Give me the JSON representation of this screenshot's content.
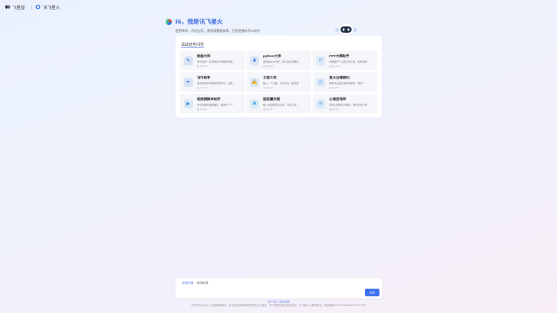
{
  "topbar": {
    "brand1": "飞星智",
    "brand2": "讯飞星火"
  },
  "hero": {
    "title": "Hi，我是讯飞星火",
    "subtitle": "使用简单，有问必答，提供海量模板库，打造更懂你的AI助手"
  },
  "card": {
    "heading": "试试这些问答",
    "assistants": [
      {
        "name": "绘画大师",
        "desc": "请你扮演一位资深设计师帮我构图…",
        "meta": "iFlyTEK",
        "icon": "paint-icon",
        "color": "#2f6be0"
      },
      {
        "name": "python大师",
        "desc": "我是python专家，请让我为您解答…",
        "meta": "iFlyTEK",
        "icon": "python-icon",
        "color": "#3b7ee0"
      },
      {
        "name": "PPT大纲助手",
        "desc": "请根据PPT主题生成大纲，结构清晰…",
        "meta": "iFlyTEK",
        "icon": "ppt-icon",
        "color": "#4d9ae6"
      },
      {
        "name": "写作助手",
        "desc": "请你扮演作家帮我构思写作，注意…",
        "meta": "iFlyTEK",
        "icon": "pen-icon",
        "color": "#2f6be0"
      },
      {
        "name": "文案大师",
        "desc": "输入一个主题，为你写出一篇文案",
        "meta": "iFlyTEK",
        "icon": "doc-icon",
        "color": "#3b7ee0"
      },
      {
        "name": "星火法律顾问",
        "desc": "提供专业的法律咨询服务，帮你…",
        "meta": "iFlyTEK",
        "icon": "scale-icon",
        "color": "#4d9ae6"
      },
      {
        "name": "短视频脚本助手",
        "desc": "请你扮演短视频编导，帮我写一个…",
        "meta": "iFlyTEK",
        "icon": "video-icon",
        "color": "#2f8fe0"
      },
      {
        "name": "朋友圈文案",
        "desc": "输入你想要发的内容，为你生成…",
        "meta": "iFlyTEK",
        "icon": "sun-icon",
        "color": "#3aa0e6"
      },
      {
        "name": "心理咨询师",
        "desc": "提供心理疏导与陪伴，倾听你的心声…",
        "meta": "iFlyTEK",
        "icon": "chat-icon",
        "color": "#4d9ae6"
      }
    ]
  },
  "input": {
    "tag1": "文档问答",
    "tag2": "有问必答",
    "send": "发送"
  },
  "footer": {
    "links": "用户协议 | 隐私政策",
    "notice": "所有内容均由人工智能模型输出，其内容的准确性和完整性无法保证，不代表我们的态度或观点。讯飞星火大模型算法 · 网信算备340104764864601230011号"
  }
}
